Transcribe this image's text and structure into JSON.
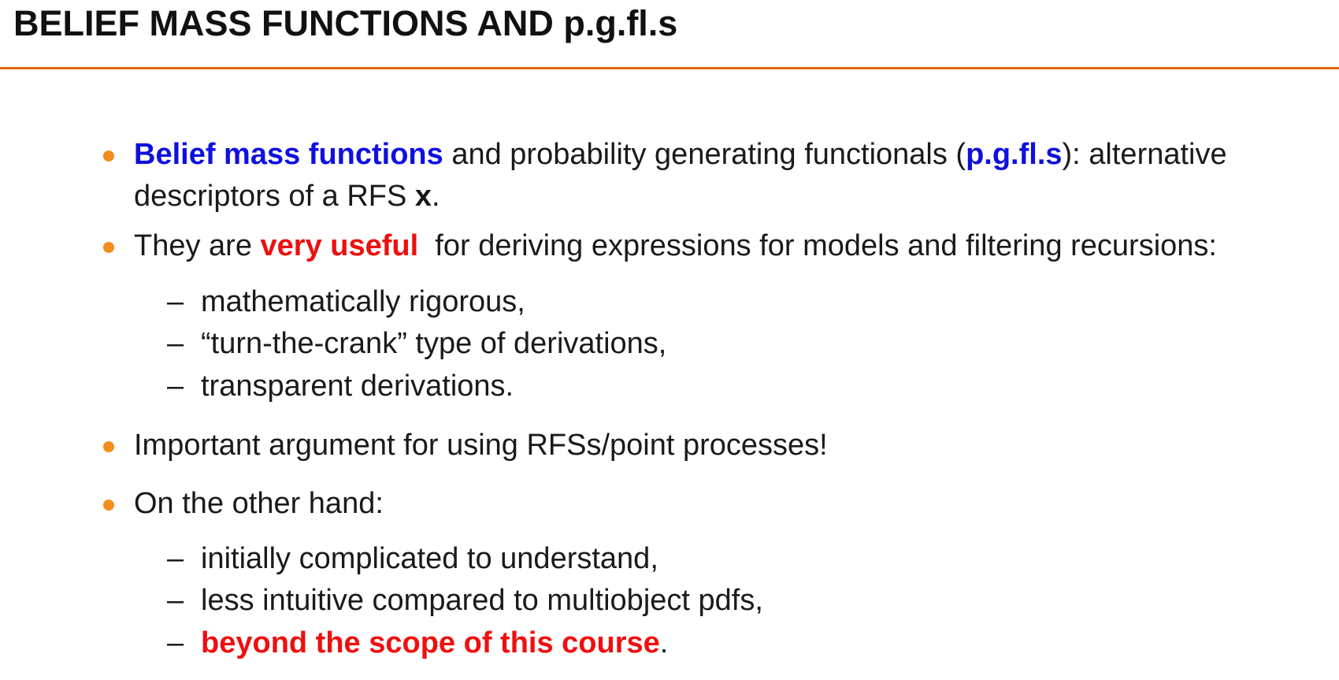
{
  "slide": {
    "title": "BELIEF MASS FUNCTIONS AND p.g.fl.s",
    "accent_color": "#e8650a",
    "bullet_color": "#f28c1c",
    "highlight_blue": "#0f0fe0",
    "highlight_red": "#ee0f0f"
  },
  "bullets": [
    {
      "term": "Belief mass functions",
      "text_a": " and probability generating functionals (",
      "term2": "p.g.fl.s",
      "text_b": "): alternative descriptors of a RFS ",
      "var": "x",
      "text_c": "."
    },
    {
      "text_a": "They are ",
      "emph": "very useful",
      "text_b": "  for deriving expressions for models and filtering recursions:",
      "subitems": [
        {
          "dash": "–",
          "text": "mathematically rigorous,"
        },
        {
          "dash": "–",
          "text": "“turn-the-crank” type of derivations,"
        },
        {
          "dash": "–",
          "text": "transparent derivations."
        }
      ]
    },
    {
      "text": "Important argument for using RFSs/point processes!"
    },
    {
      "text": "On the other hand:",
      "subitems": [
        {
          "dash": "–",
          "text": "initially complicated to understand,"
        },
        {
          "dash": "–",
          "text": "less intuitive compared to multiobject pdfs,"
        },
        {
          "dash": "–",
          "emph": "beyond the scope of this course",
          "text_after": "."
        }
      ]
    }
  ]
}
